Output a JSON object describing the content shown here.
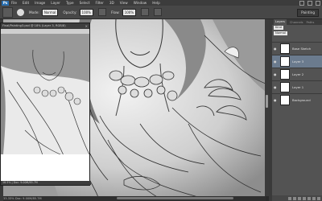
{
  "menu": {
    "logo": "Ps",
    "items": [
      "File",
      "Edit",
      "Image",
      "Layer",
      "Type",
      "Select",
      "Filter",
      "3D",
      "View",
      "Window",
      "Help"
    ]
  },
  "options": {
    "mode_label": "Mode:",
    "mode_value": "Normal",
    "opacity_label": "Opacity:",
    "opacity_value": "100%",
    "flow_label": "Flow:",
    "flow_value": "100%",
    "workspace": "Painting"
  },
  "float_doc": {
    "title": "Final/Painting3.psd @ 18% (Layer 3, RGB/8)",
    "close": "×",
    "status": "18.5% | Doc: 9.00M/85.7M"
  },
  "main_status": "33.33%  Doc: 9.00M/85.7M",
  "layers": {
    "tabs": [
      "Layers",
      "Channels",
      "Paths"
    ],
    "kind": "Kind",
    "blend": "Normal",
    "items": [
      {
        "name": "Base Sketch",
        "visible": true,
        "selected": false
      },
      {
        "name": "Layer 3",
        "visible": true,
        "selected": true
      },
      {
        "name": "Layer 2",
        "visible": true,
        "selected": false
      },
      {
        "name": "Layer 1",
        "visible": true,
        "selected": false
      },
      {
        "name": "Background",
        "visible": true,
        "selected": false
      }
    ]
  }
}
